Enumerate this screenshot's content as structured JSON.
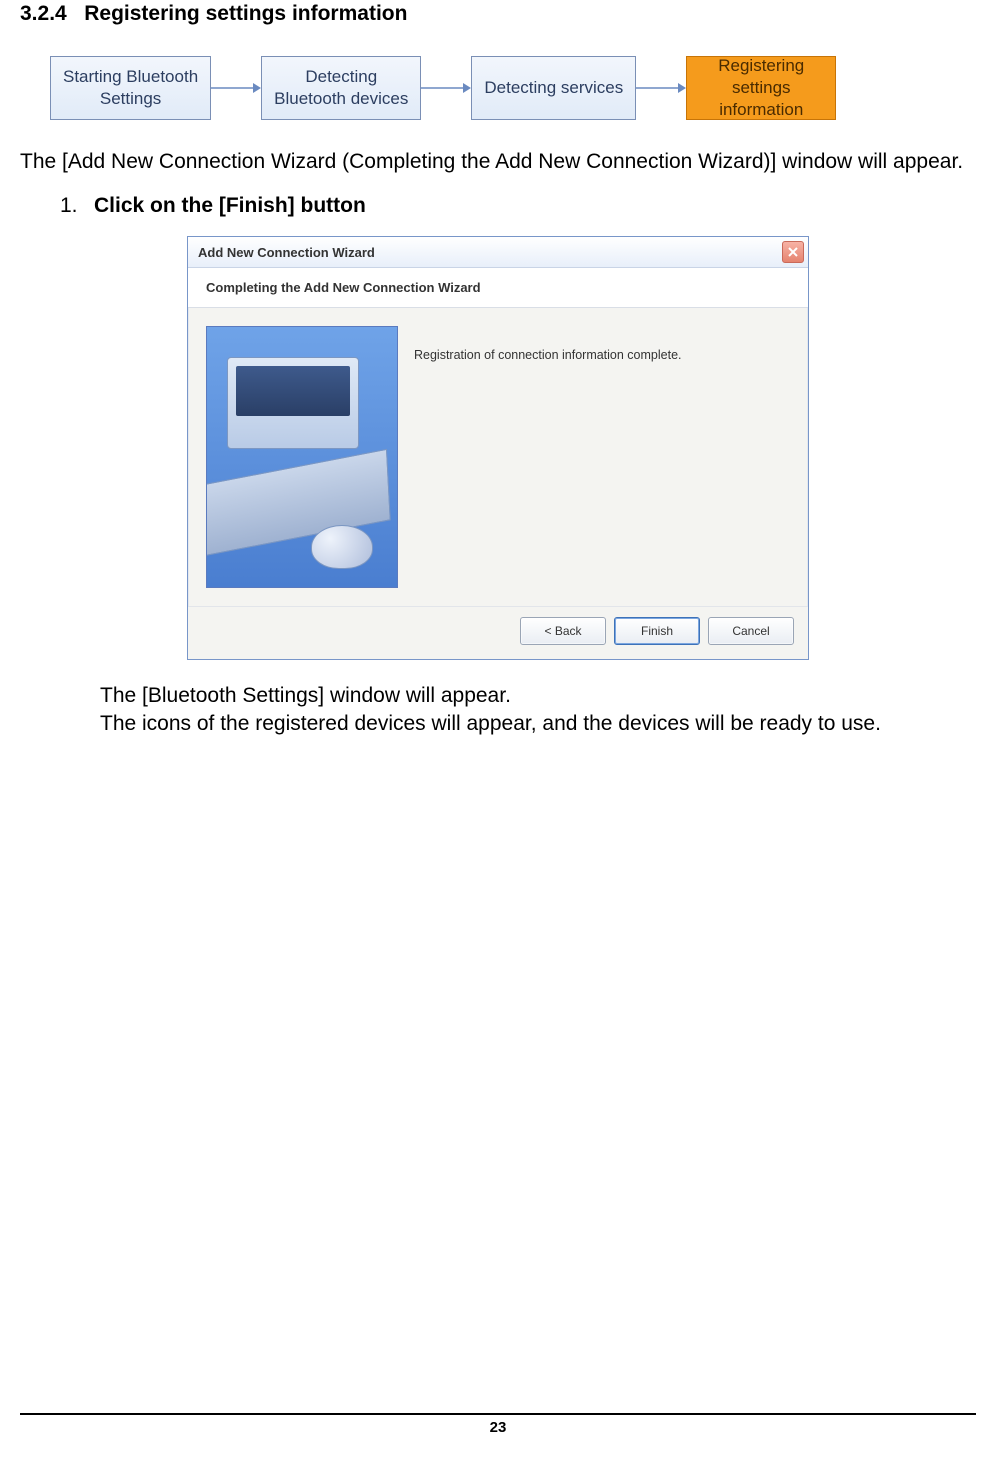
{
  "section": {
    "number": "3.2.4",
    "title": "Registering settings information"
  },
  "flow": {
    "steps": [
      {
        "line1": "Starting Bluetooth",
        "line2": "Settings",
        "active": false
      },
      {
        "line1": "Detecting",
        "line2": "Bluetooth devices",
        "active": false
      },
      {
        "line1": "Detecting services",
        "line2": "",
        "active": false
      },
      {
        "line1": "Registering",
        "line2": "settings",
        "line3": "information",
        "active": true
      }
    ]
  },
  "intro_text": "The [Add New Connection Wizard (Completing the Add New Connection Wizard)] window will appear.",
  "list": {
    "items": [
      {
        "num": "1.",
        "label": "Click on the [Finish] button"
      }
    ]
  },
  "wizard": {
    "title": "Add New Connection Wizard",
    "banner": "Completing the Add New Connection Wizard",
    "body_text": "Registration of connection information complete.",
    "buttons": {
      "back": "< Back",
      "finish": "Finish",
      "cancel": "Cancel"
    }
  },
  "after_shot": {
    "line1": "The [Bluetooth Settings] window will appear.",
    "line2": "The icons of the registered devices will appear, and the devices will be ready to use."
  },
  "page_number": "23"
}
